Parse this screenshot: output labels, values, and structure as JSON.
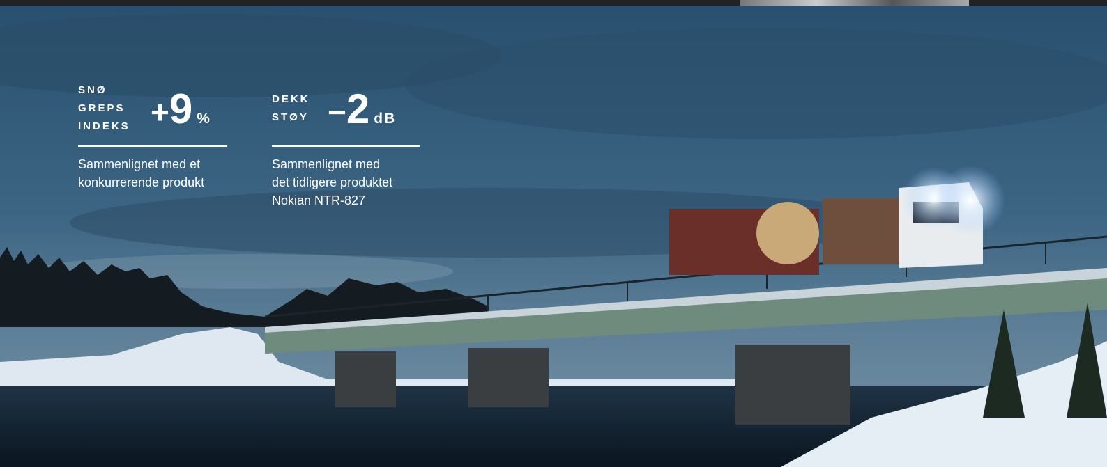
{
  "stats": [
    {
      "label_lines": [
        "SNØ",
        "GREPS",
        "INDEKS"
      ],
      "sign": "+",
      "value": "9",
      "unit": "%",
      "description": "Sammenlignet med et\nkonkurrerende produkt"
    },
    {
      "label_lines": [
        "DEKK",
        "STØY"
      ],
      "sign": "−",
      "value": "2",
      "unit": "dB",
      "description": "Sammenlignet med\ndet tidligere produktet\nNokian NTR-827"
    }
  ],
  "colors": {
    "sky_top": "#2e5573",
    "sky_bottom": "#5b7f98",
    "text": "#ffffff",
    "bridge": "#6e8b7e",
    "water": "#0f1d2b",
    "snow": "#e6eef5"
  }
}
